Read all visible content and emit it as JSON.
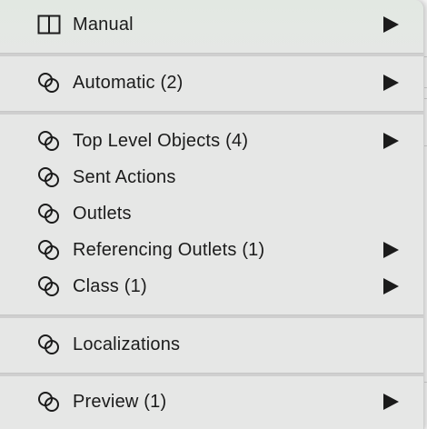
{
  "menu": {
    "items": [
      {
        "label": "Manual",
        "icon": "split-view-icon",
        "has_submenu": true
      },
      {
        "label": "Automatic (2)",
        "icon": "linked-circles-icon",
        "has_submenu": true
      },
      {
        "label": "Top Level Objects (4)",
        "icon": "linked-circles-icon",
        "has_submenu": true
      },
      {
        "label": "Sent Actions",
        "icon": "linked-circles-icon",
        "has_submenu": false
      },
      {
        "label": "Outlets",
        "icon": "linked-circles-icon",
        "has_submenu": false
      },
      {
        "label": "Referencing Outlets (1)",
        "icon": "linked-circles-icon",
        "has_submenu": true
      },
      {
        "label": "Class (1)",
        "icon": "linked-circles-icon",
        "has_submenu": true
      },
      {
        "label": "Localizations",
        "icon": "linked-circles-icon",
        "has_submenu": false
      },
      {
        "label": "Preview (1)",
        "icon": "linked-circles-icon",
        "has_submenu": true
      }
    ]
  },
  "colors": {
    "menu_background": "#e6e7e6",
    "text": "#1b1b1b",
    "separator": "#cfcfcf"
  }
}
